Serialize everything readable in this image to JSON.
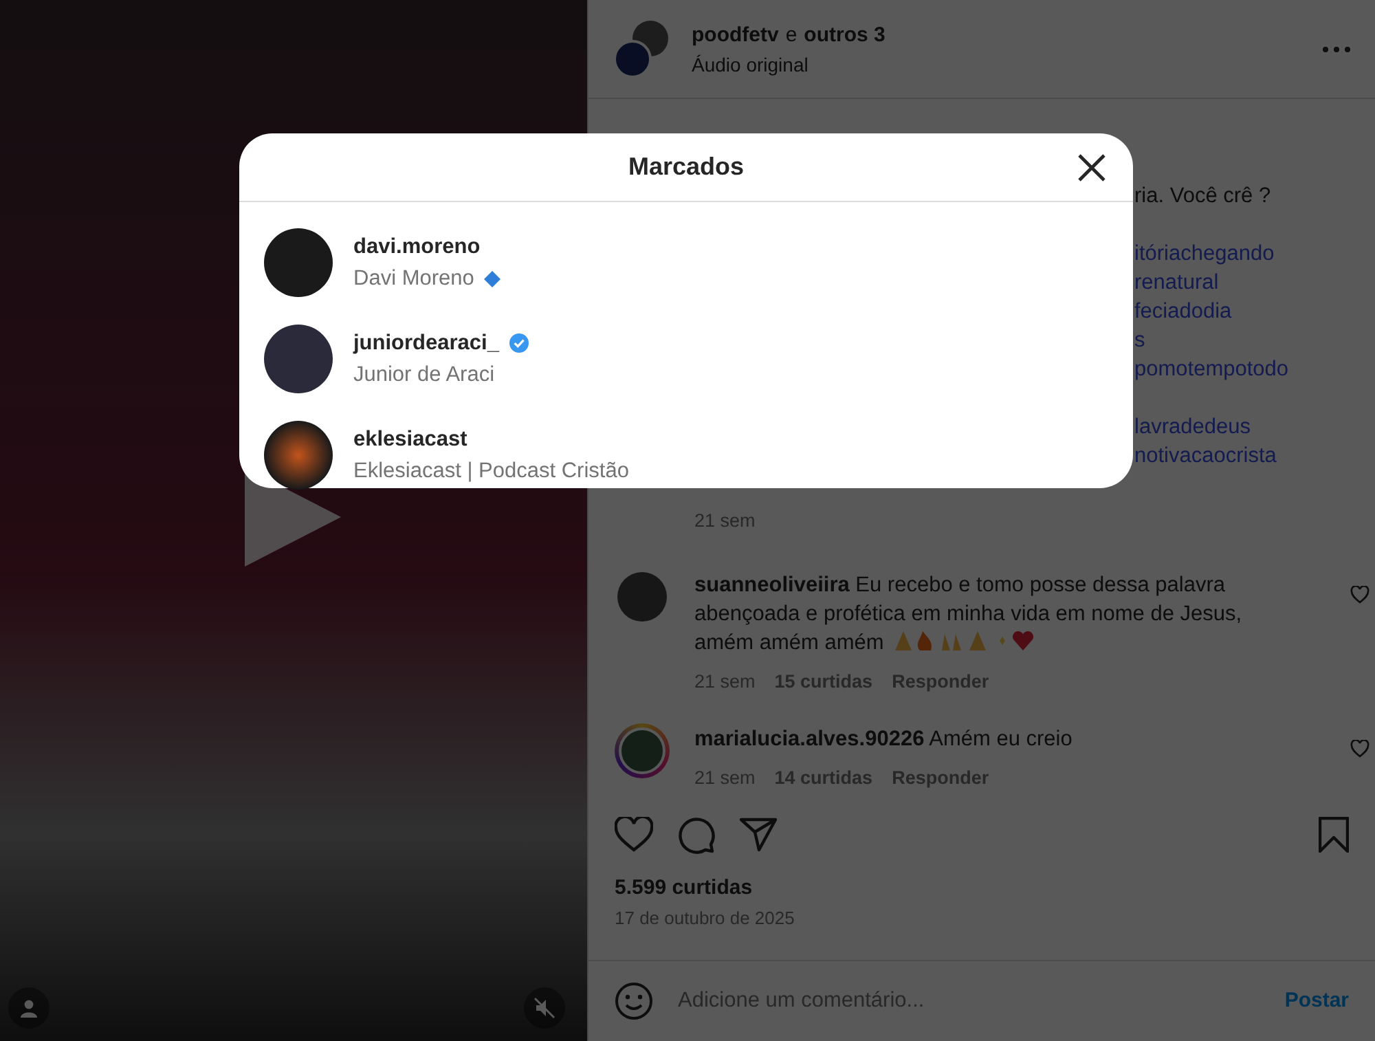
{
  "post": {
    "header": {
      "author": "poodfetv",
      "connector": "e",
      "others": "outros 3",
      "audio": "Áudio original"
    },
    "caption": [
      {
        "kind": "text",
        "lines": [
          "ria. Você crê ?"
        ]
      },
      {
        "kind": "hashtags",
        "lines": [
          "itóriachegando",
          "renatural",
          "feciadodia",
          "s",
          "pomotempotodo"
        ]
      },
      {
        "kind": "hashtags",
        "lines": [
          "lavradedeus",
          "notivacaocrista"
        ]
      }
    ],
    "caption_time": "21 sem",
    "comments": [
      {
        "username": "suanneoliveiira",
        "text": "Eu recebo e tomo posse dessa palavra abençoada e profética em minha vida em nome de Jesus, amém amém amém",
        "emoji": true,
        "time": "21 sem",
        "likes": "15 curtidas",
        "reply": "Responder",
        "story_ring": false
      },
      {
        "username": "marialucia.alves.90226",
        "text": "Amém eu creio",
        "emoji": false,
        "time": "21 sem",
        "likes": "14 curtidas",
        "reply": "Responder",
        "story_ring": true
      }
    ],
    "likes": "5.599 curtidas",
    "date": "17 de outubro de 2025",
    "comment_placeholder": "Adicione um comentário...",
    "post_button": "Postar"
  },
  "modal": {
    "title": "Marcados",
    "users": [
      {
        "username": "davi.moreno",
        "full_name": "Davi Moreno",
        "kind": "diamond"
      },
      {
        "username": "juniordearaci_",
        "full_name": "Junior de Araci",
        "kind": "verified"
      },
      {
        "username": "eklesiacast",
        "full_name": "Eklesiacast | Podcast Cristão",
        "kind": "plain"
      }
    ]
  }
}
